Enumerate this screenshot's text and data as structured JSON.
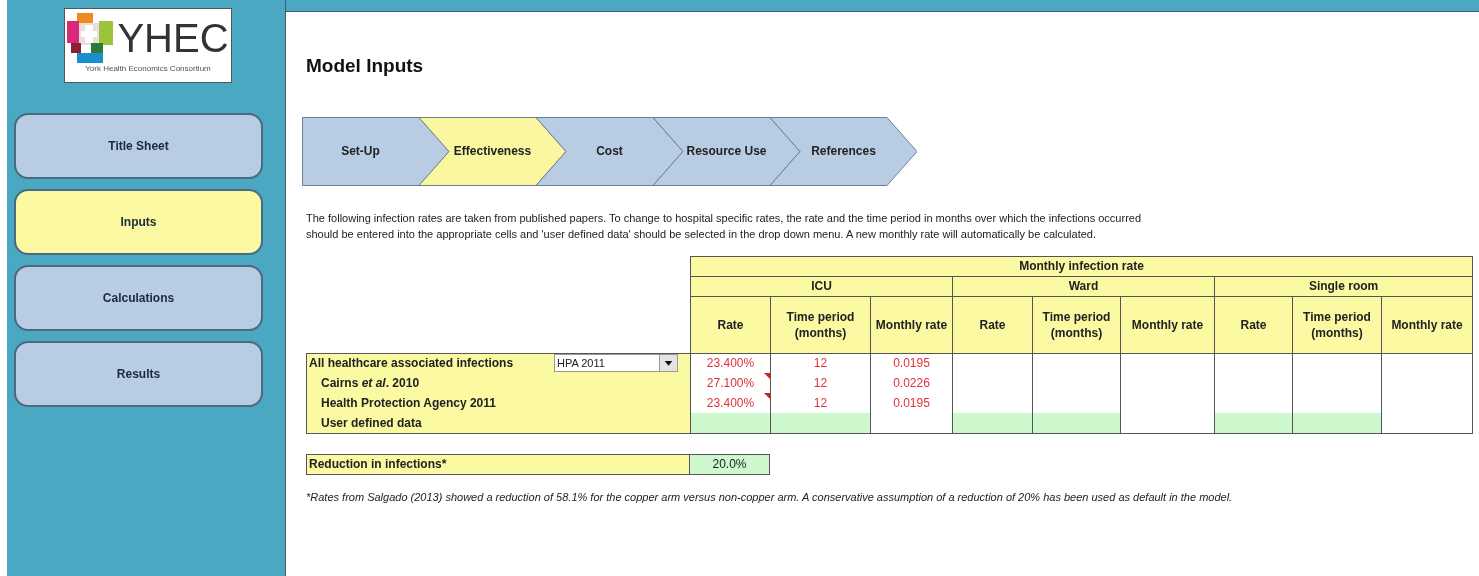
{
  "logo": {
    "name": "YHEC",
    "subtitle": "York Health Economics Consortium"
  },
  "sidebar": {
    "items": [
      {
        "label": "Title Sheet",
        "selected": false
      },
      {
        "label": "Inputs",
        "selected": true
      },
      {
        "label": "Calculations",
        "selected": false
      },
      {
        "label": "Results",
        "selected": false
      }
    ]
  },
  "title": "Model Inputs",
  "steps": [
    {
      "label": "Set-Up",
      "selected": false
    },
    {
      "label": "Effectiveness",
      "selected": true
    },
    {
      "label": "Cost",
      "selected": false
    },
    {
      "label": "Resource Use",
      "selected": false
    },
    {
      "label": "References",
      "selected": false
    }
  ],
  "intro": [
    "The following infection rates are taken from published papers. To change to hospital specific rates, the rate and the time period in months over which the infections occurred",
    "should be entered into the appropriate cells and 'user defined data' should be selected in the drop down menu. A new monthly rate will automatically be calculated."
  ],
  "table": {
    "title": "Monthly infection rate",
    "groups": [
      "ICU",
      "Ward",
      "Single room"
    ],
    "columns": [
      "Rate",
      "Time period (months)",
      "Monthly rate",
      "Rate",
      "Time period (months)",
      "Monthly rate",
      "Rate",
      "Time period (months)",
      "Monthly rate"
    ],
    "rows": [
      {
        "kind": "main",
        "label": "All healthcare associated infections",
        "dropdown": "HPA 2011",
        "cells": [
          {
            "kind": "output",
            "value": "23.400%",
            "comment": false
          },
          {
            "kind": "output",
            "value": "12",
            "comment": false
          },
          {
            "kind": "output",
            "value": "0.0195",
            "comment": false
          },
          {
            "kind": "blank"
          },
          {
            "kind": "blank"
          },
          {
            "kind": "blank"
          },
          {
            "kind": "blank"
          },
          {
            "kind": "blank"
          },
          {
            "kind": "blank"
          }
        ]
      },
      {
        "kind": "sub",
        "label": "Cairns *et al*. 2010",
        "cells": [
          {
            "kind": "output",
            "value": "27.100%",
            "comment": true
          },
          {
            "kind": "output",
            "value": "12",
            "comment": false
          },
          {
            "kind": "output",
            "value": "0.0226",
            "comment": false
          },
          {
            "kind": "blank"
          },
          {
            "kind": "blank"
          },
          {
            "kind": "blank"
          },
          {
            "kind": "blank"
          },
          {
            "kind": "blank"
          },
          {
            "kind": "blank"
          }
        ]
      },
      {
        "kind": "sub",
        "label": "Health Protection Agency 2011",
        "cells": [
          {
            "kind": "output",
            "value": "23.400%",
            "comment": true
          },
          {
            "kind": "output",
            "value": "12",
            "comment": false
          },
          {
            "kind": "output",
            "value": "0.0195",
            "comment": false
          },
          {
            "kind": "blank"
          },
          {
            "kind": "blank"
          },
          {
            "kind": "blank"
          },
          {
            "kind": "blank"
          },
          {
            "kind": "blank"
          },
          {
            "kind": "blank"
          }
        ]
      },
      {
        "kind": "sub",
        "label": "User defined data",
        "cells": [
          {
            "kind": "input"
          },
          {
            "kind": "input"
          },
          {
            "kind": "blank"
          },
          {
            "kind": "input"
          },
          {
            "kind": "input"
          },
          {
            "kind": "blank"
          },
          {
            "kind": "input"
          },
          {
            "kind": "input"
          },
          {
            "kind": "blank"
          }
        ]
      }
    ]
  },
  "reduction": {
    "label": "Reduction in infections*",
    "value": "20.0%"
  },
  "footnote": "*Rates from Salgado (2013) showed a reduction of 58.1% for the copper arm versus non-copper arm.  A conservative assumption of a reduction of 20% has been used as default in the model."
}
